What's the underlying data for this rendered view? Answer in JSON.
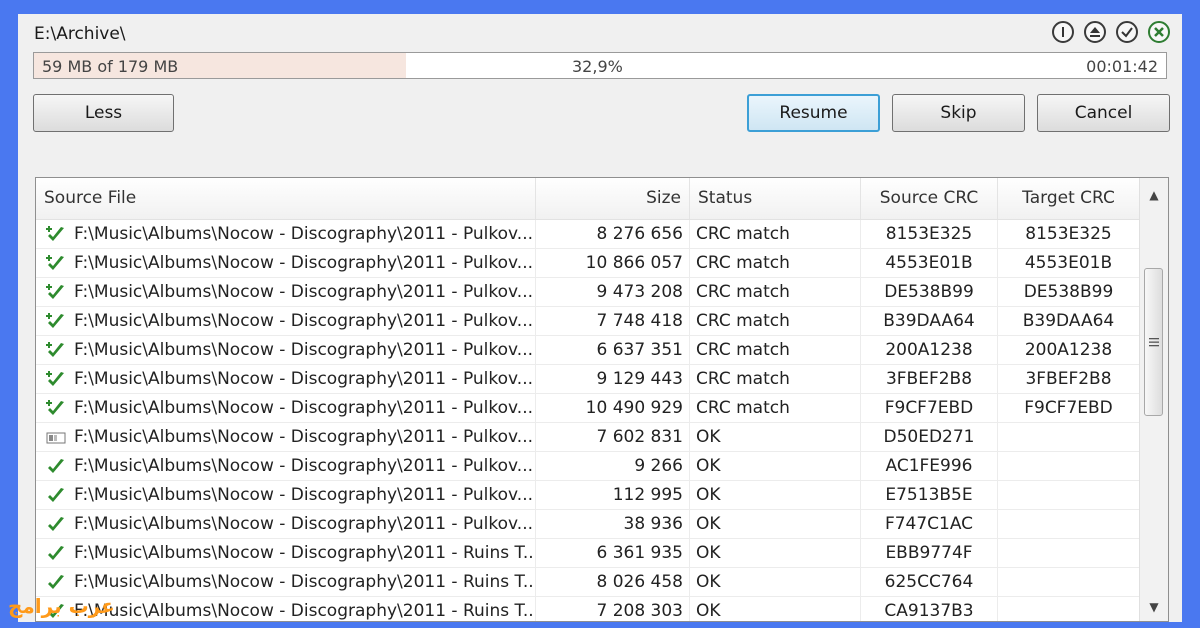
{
  "window": {
    "path": "E:\\Archive\\",
    "top_icons": [
      "info-icon",
      "eject-icon",
      "check-icon",
      "close-icon"
    ]
  },
  "progress": {
    "copied": "59 MB of 179 MB",
    "percent_label": "32,9%",
    "fraction": 0.329,
    "time": "00:01:42",
    "fill_color": "#f6e6df"
  },
  "buttons": {
    "less": "Less",
    "resume": "Resume",
    "skip": "Skip",
    "cancel": "Cancel"
  },
  "table": {
    "headers": {
      "source": "Source File",
      "size": "Size",
      "status": "Status",
      "source_crc": "Source CRC",
      "target_crc": "Target CRC"
    },
    "rows": [
      {
        "icon": "check-plus-icon",
        "file": "F:\\Music\\Albums\\Nocow - Discography\\2011 - Pulkov...",
        "size": "8 276 656",
        "status": "CRC match",
        "src": "8153E325",
        "tgt": "8153E325"
      },
      {
        "icon": "check-plus-icon",
        "file": "F:\\Music\\Albums\\Nocow - Discography\\2011 - Pulkov...",
        "size": "10 866 057",
        "status": "CRC match",
        "src": "4553E01B",
        "tgt": "4553E01B"
      },
      {
        "icon": "check-plus-icon",
        "file": "F:\\Music\\Albums\\Nocow - Discography\\2011 - Pulkov...",
        "size": "9 473 208",
        "status": "CRC match",
        "src": "DE538B99",
        "tgt": "DE538B99"
      },
      {
        "icon": "check-plus-icon",
        "file": "F:\\Music\\Albums\\Nocow - Discography\\2011 - Pulkov...",
        "size": "7 748 418",
        "status": "CRC match",
        "src": "B39DAA64",
        "tgt": "B39DAA64"
      },
      {
        "icon": "check-plus-icon",
        "file": "F:\\Music\\Albums\\Nocow - Discography\\2011 - Pulkov...",
        "size": "6 637 351",
        "status": "CRC match",
        "src": "200A1238",
        "tgt": "200A1238"
      },
      {
        "icon": "check-plus-icon",
        "file": "F:\\Music\\Albums\\Nocow - Discography\\2011 - Pulkov...",
        "size": "9 129 443",
        "status": "CRC match",
        "src": "3FBEF2B8",
        "tgt": "3FBEF2B8"
      },
      {
        "icon": "check-plus-icon",
        "file": "F:\\Music\\Albums\\Nocow - Discography\\2011 - Pulkov...",
        "size": "10 490 929",
        "status": "CRC match",
        "src": "F9CF7EBD",
        "tgt": "F9CF7EBD"
      },
      {
        "icon": "progress-file-icon",
        "file": "F:\\Music\\Albums\\Nocow - Discography\\2011 - Pulkov...",
        "size": "7 602 831",
        "status": "OK",
        "src": "D50ED271",
        "tgt": ""
      },
      {
        "icon": "check-icon",
        "file": "F:\\Music\\Albums\\Nocow - Discography\\2011 - Pulkov...",
        "size": "9 266",
        "status": "OK",
        "src": "AC1FE996",
        "tgt": ""
      },
      {
        "icon": "check-icon",
        "file": "F:\\Music\\Albums\\Nocow - Discography\\2011 - Pulkov...",
        "size": "112 995",
        "status": "OK",
        "src": "E7513B5E",
        "tgt": ""
      },
      {
        "icon": "check-icon",
        "file": "F:\\Music\\Albums\\Nocow - Discography\\2011 - Pulkov...",
        "size": "38 936",
        "status": "OK",
        "src": "F747C1AC",
        "tgt": ""
      },
      {
        "icon": "check-icon",
        "file": "F:\\Music\\Albums\\Nocow - Discography\\2011 - Ruins T...",
        "size": "6 361 935",
        "status": "OK",
        "src": "EBB9774F",
        "tgt": ""
      },
      {
        "icon": "check-icon",
        "file": "F:\\Music\\Albums\\Nocow - Discography\\2011 - Ruins T...",
        "size": "8 026 458",
        "status": "OK",
        "src": "625CC764",
        "tgt": ""
      },
      {
        "icon": "check-icon",
        "file": "F:\\Music\\Albums\\Nocow - Discography\\2011 - Ruins T...",
        "size": "7 208 303",
        "status": "OK",
        "src": "CA9137B3",
        "tgt": ""
      }
    ]
  },
  "watermark": "عرب برامج",
  "colors": {
    "border_bg": "#4a78f0",
    "check_green": "#2e8b2e",
    "primary_border": "#3c9fd6"
  }
}
